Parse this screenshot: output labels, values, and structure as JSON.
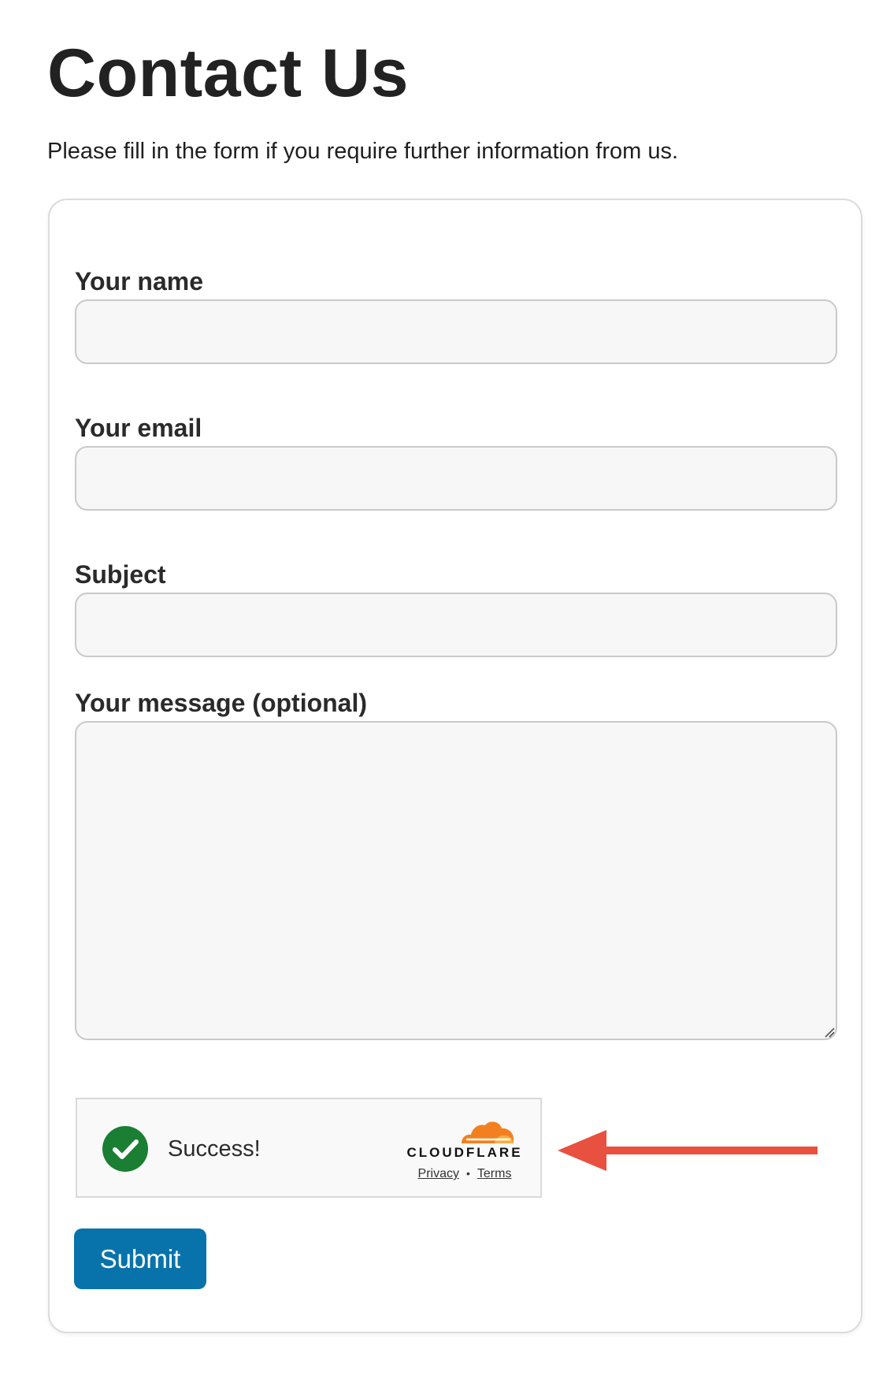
{
  "page": {
    "title": "Contact Us",
    "subtitle": "Please fill in the form if you require further information from us."
  },
  "form": {
    "fields": [
      {
        "label": "Your name",
        "value": ""
      },
      {
        "label": "Your email",
        "value": ""
      },
      {
        "label": "Subject",
        "value": ""
      },
      {
        "label": "Your message (optional)",
        "value": ""
      }
    ],
    "submit_label": "Submit"
  },
  "captcha": {
    "status_text": "Success!",
    "brand": "CLOUDFLARE",
    "privacy_label": "Privacy",
    "separator": "•",
    "terms_label": "Terms",
    "icons": {
      "status": "check-circle-icon",
      "brand": "cloudflare-cloud-icon"
    }
  },
  "annotation": {
    "icon": "arrow-left-icon"
  },
  "colors": {
    "accent": "#0873ab",
    "success": "#1a7e33",
    "cloudflare_orange": "#f38020",
    "annotation_arrow": "#e8503f"
  }
}
